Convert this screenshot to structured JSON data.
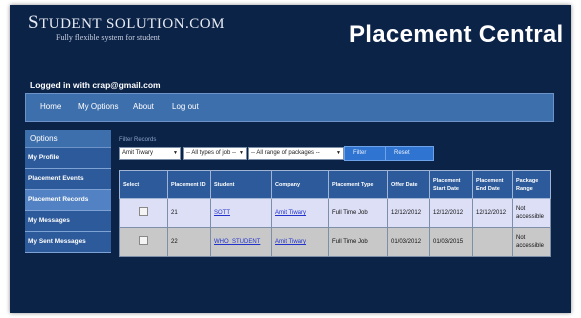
{
  "brand": {
    "name_initial": "S",
    "name_rest": "TUDENT SOLUTION.COM",
    "tagline": "Fully flexible system for student"
  },
  "app_title": "Placement Central",
  "login_text": "Logged in with crap@gmail.com",
  "topnav": {
    "items": [
      "Home",
      "My Options",
      "About",
      "Log out"
    ]
  },
  "sidebar": {
    "heading": "Options",
    "items": [
      "My Profile",
      "Placement Events",
      "Placement Records",
      "My Messages",
      "My Sent Messages"
    ],
    "active_item": "Placement Records"
  },
  "filter": {
    "label": "Filter Records",
    "student_select": "Amit Tiwary",
    "job_type_select": "-- All types of job --",
    "package_select": "-- All range of packages --",
    "filter_button": "Filter",
    "reset_button": "Reset"
  },
  "table": {
    "headers": [
      "Select",
      "Placement ID",
      "Student",
      "Company",
      "Placement Type",
      "Offer Date",
      "Placement Start Date",
      "Placement End Date",
      "Package Range"
    ],
    "rows": [
      {
        "id": "21",
        "student": "SOTT",
        "company": "Amit Tiwary",
        "type": "Full Time Job",
        "offer_date": "12/12/2012",
        "start_date": "12/12/2012",
        "end_date": "12/12/2012",
        "package": "Not accessible"
      },
      {
        "id": "22",
        "student": "WHO_STUDENT",
        "company": "Amit Tiwary",
        "type": "Full Time Job",
        "offer_date": "01/03/2012",
        "start_date": "01/03/2015",
        "end_date": "",
        "package": "Not accessible"
      }
    ]
  }
}
